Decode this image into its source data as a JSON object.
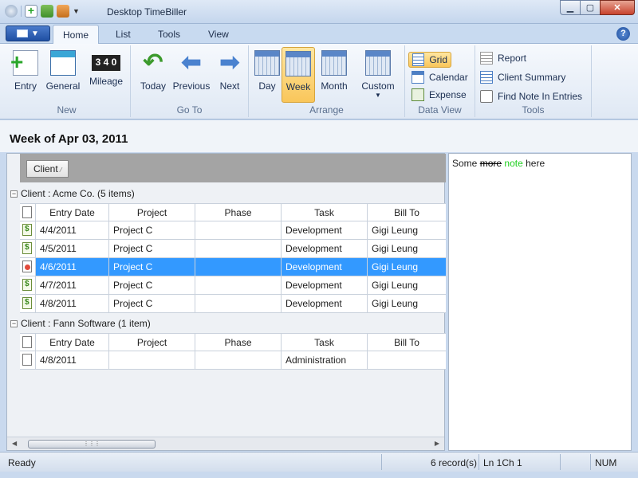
{
  "window": {
    "title": "Desktop TimeBiller"
  },
  "tabs": [
    "Home",
    "List",
    "Tools",
    "View"
  ],
  "active_tab": "Home",
  "ribbon": {
    "new": {
      "label": "New",
      "buttons": [
        "Entry",
        "General",
        "Mileage"
      ]
    },
    "goto": {
      "label": "Go To",
      "buttons": [
        "Today",
        "Previous",
        "Next"
      ]
    },
    "arrange": {
      "label": "Arrange",
      "buttons": [
        "Day",
        "Week",
        "Month",
        "Custom"
      ],
      "selected": "Week"
    },
    "dataview": {
      "label": "Data View",
      "buttons": [
        "Grid",
        "Calendar",
        "Expense"
      ],
      "selected": "Grid"
    },
    "tools": {
      "label": "Tools",
      "buttons": [
        "Report",
        "Client Summary",
        "Find Note In Entries"
      ]
    }
  },
  "week_title": "Week of Apr 03, 2011",
  "group_by_chip": "Client",
  "columns": [
    "Entry Date",
    "Project",
    "Phase",
    "Task",
    "Bill To"
  ],
  "groups": [
    {
      "header": "Client : Acme Co. (5 items)",
      "rows": [
        {
          "date": "4/4/2011",
          "project": "Project C",
          "phase": "",
          "task": "Development",
          "bill_to": "Gigi Leung",
          "icon": "money"
        },
        {
          "date": "4/5/2011",
          "project": "Project C",
          "phase": "",
          "task": "Development",
          "bill_to": "Gigi Leung",
          "icon": "money"
        },
        {
          "date": "4/6/2011",
          "project": "Project C",
          "phase": "",
          "task": "Development",
          "bill_to": "Gigi Leung",
          "icon": "flag"
        },
        {
          "date": "4/7/2011",
          "project": "Project C",
          "phase": "",
          "task": "Development",
          "bill_to": "Gigi Leung",
          "icon": "money"
        },
        {
          "date": "4/8/2011",
          "project": "Project C",
          "phase": "",
          "task": "Development",
          "bill_to": "Gigi Leung",
          "icon": "money"
        }
      ]
    },
    {
      "header": "Client : Fann Software (1 item)",
      "rows": [
        {
          "date": "4/8/2011",
          "project": "",
          "phase": "",
          "task": "Administration",
          "bill_to": "",
          "icon": "plain"
        }
      ]
    }
  ],
  "note": {
    "word1": "Some",
    "struck": "more",
    "green": "note",
    "word3": "here"
  },
  "status": {
    "ready": "Ready",
    "records": "6 record(s)",
    "position": "Ln 1Ch 1",
    "num": "NUM"
  },
  "colors": {
    "selection": "#3399ff",
    "ribbon_selected": "#f9c65a",
    "note_green": "#1ecf1e"
  }
}
